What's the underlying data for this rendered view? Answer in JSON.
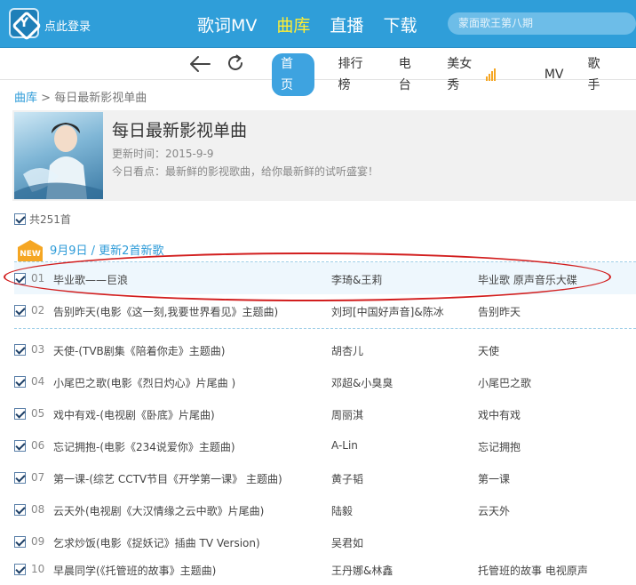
{
  "topbar": {
    "login": "点此登录",
    "nav": [
      "歌词MV",
      "曲库",
      "直播",
      "下载"
    ],
    "search_placeholder": "蒙面歌王第八期"
  },
  "subnav": {
    "tabs": [
      "首页",
      "排行榜",
      "电台",
      "美女秀",
      "MV",
      "歌手"
    ]
  },
  "breadcrumb": {
    "root": "曲库",
    "sep": ">",
    "current": "每日最新影视单曲"
  },
  "header": {
    "title": "每日最新影视单曲",
    "updated": "更新时间：2015-9-9",
    "desc": "今日看点：最新鲜的影视歌曲，给你最新鲜的试听盛宴！"
  },
  "count": "共251首",
  "group": {
    "badge": "NEW",
    "heading": "9月9日 / 更新2首新歌"
  },
  "songs": [
    {
      "num": "01",
      "title": "毕业歌——巨浪",
      "artist": "李琦&王莉",
      "album": "毕业歌 原声音乐大碟"
    },
    {
      "num": "02",
      "title": "告别昨天(电影《这一刻,我要世界看见》主题曲)",
      "artist": "刘珂[中国好声音]&陈冰",
      "album": "告别昨天"
    },
    {
      "num": "03",
      "title": "天使-(TVB剧集《陪着你走》主题曲)",
      "artist": "胡杏儿",
      "album": "天使"
    },
    {
      "num": "04",
      "title": "小尾巴之歌(电影《烈日灼心》片尾曲 )",
      "artist": "邓超&小臭臭",
      "album": "小尾巴之歌"
    },
    {
      "num": "05",
      "title": "戏中有戏-(电视剧《卧底》片尾曲)",
      "artist": "周丽淇",
      "album": "戏中有戏"
    },
    {
      "num": "06",
      "title": "忘记拥抱-(电影《234说爱你》主题曲)",
      "artist": "A-Lin",
      "album": "忘记拥抱"
    },
    {
      "num": "07",
      "title": "第一课-(综艺 CCTV节目《开学第一课》 主题曲)",
      "artist": "黄子韬",
      "album": "第一课"
    },
    {
      "num": "08",
      "title": "云天外(电视剧《大汉情缘之云中歌》片尾曲)",
      "artist": "陆毅",
      "album": "云天外"
    },
    {
      "num": "09",
      "title": "乞求炒饭(电影《捉妖记》插曲 TV Version)",
      "artist": "吴君如",
      "album": ""
    },
    {
      "num": "10",
      "title": "早晨同学(《托管班的故事》主题曲)",
      "artist": "王丹娜&林鑫",
      "album": "托管班的故事 电视原声"
    }
  ]
}
